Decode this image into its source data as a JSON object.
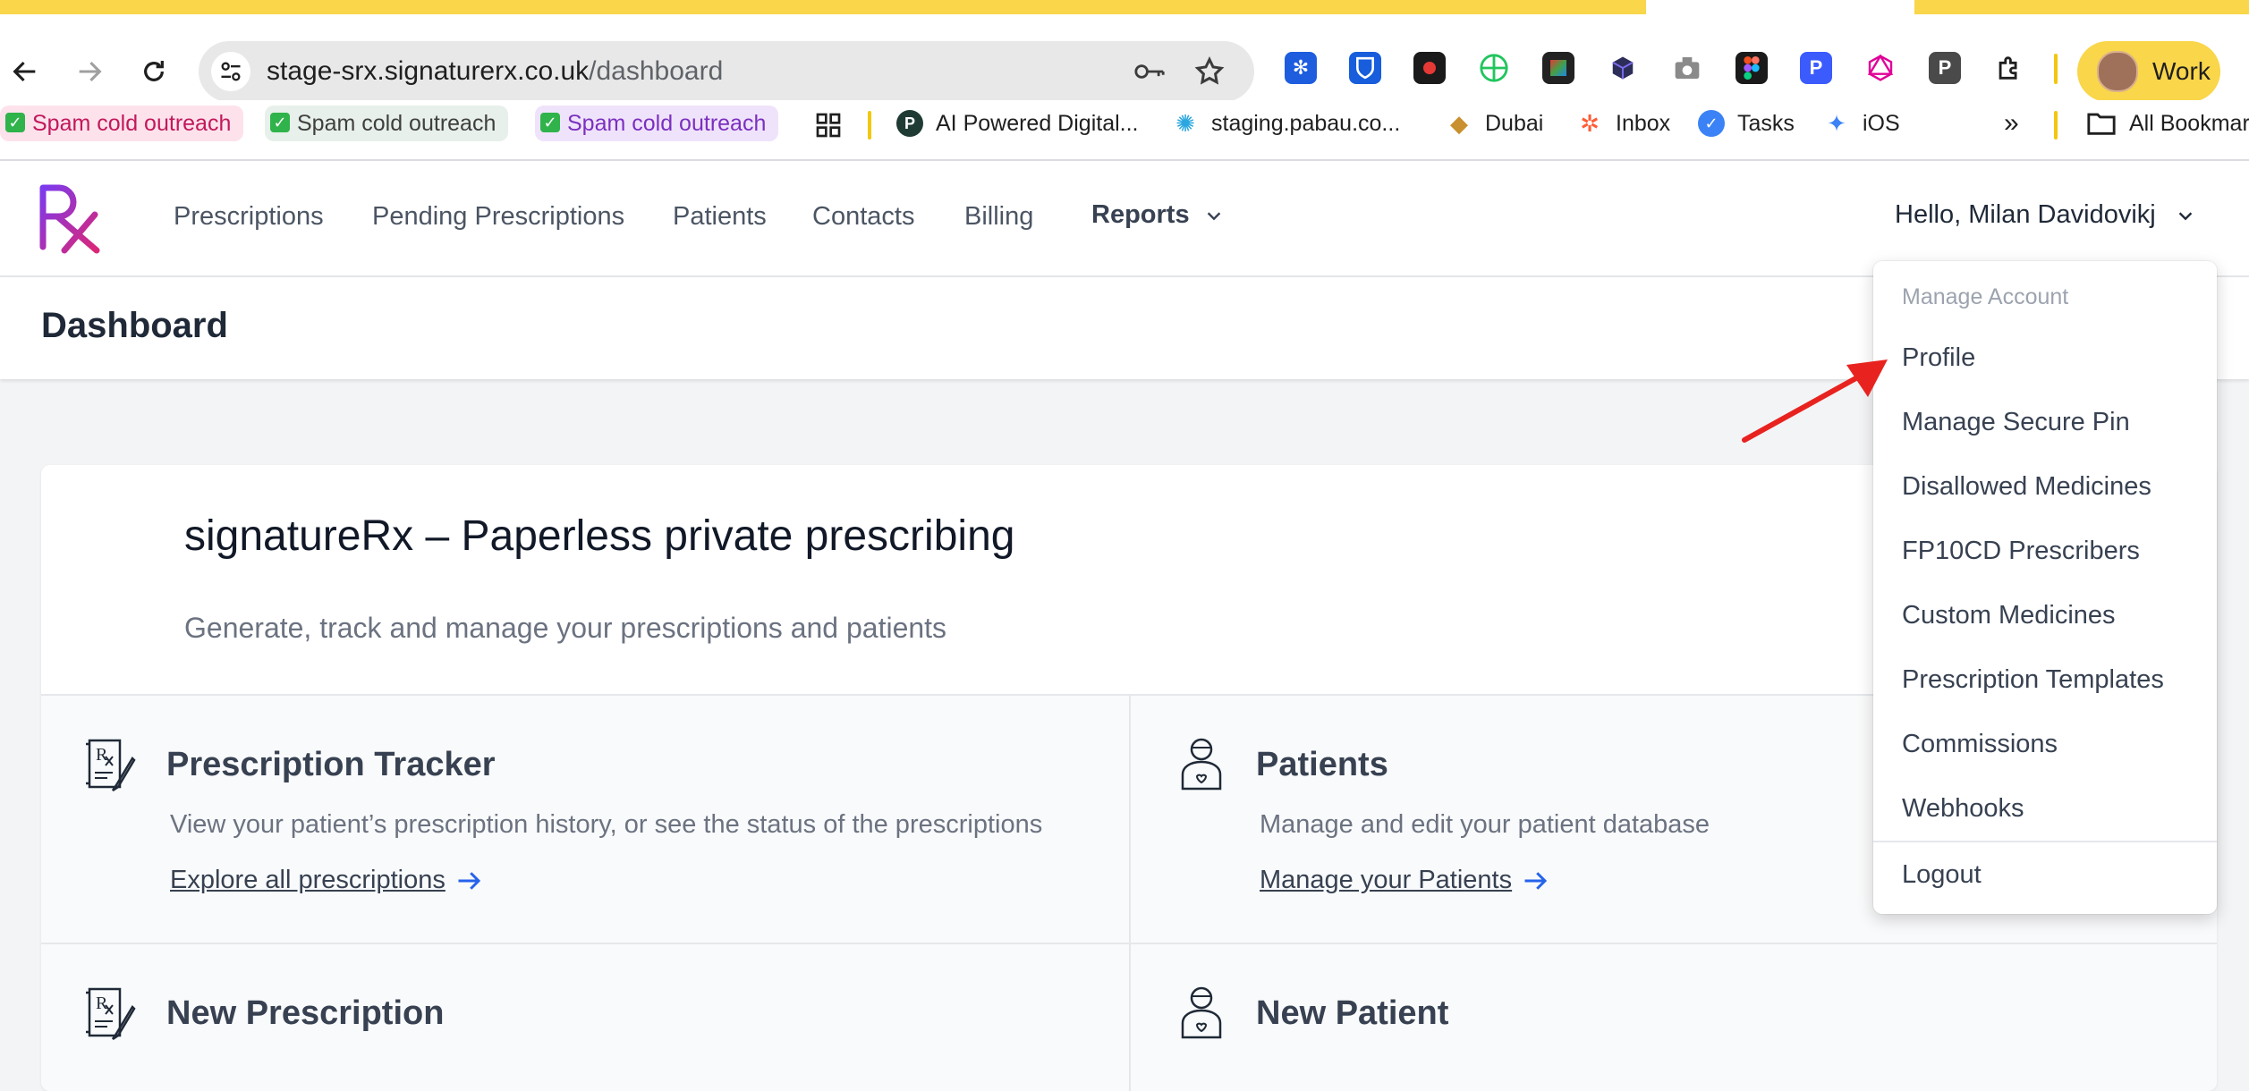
{
  "browser": {
    "url_host": "stage-srx.signaturerx.co.uk",
    "url_path": "/dashboard",
    "profile_label": "Work",
    "bookmarks_chips": [
      "Spam cold outreach",
      "Spam cold outreach",
      "Spam cold outreach"
    ],
    "bookmarks": [
      "AI Powered Digital...",
      "staging.pabau.co...",
      "Dubai",
      "Inbox",
      "Tasks",
      "iOS"
    ],
    "all_bookmarks": "All Bookmarks",
    "overflow": "»"
  },
  "app": {
    "logo_text": "Rx",
    "nav": [
      "Prescriptions",
      "Pending Prescriptions",
      "Patients",
      "Contacts",
      "Billing"
    ],
    "reports_label": "Reports",
    "greeting": "Hello, Milan Davidovikj"
  },
  "page": {
    "title": "Dashboard",
    "hero_title": "signatureRx – Paperless private prescribing",
    "hero_subtitle": "Generate, track and manage your prescriptions and patients"
  },
  "tiles": [
    {
      "title": "Prescription Tracker",
      "desc": "View your patient’s prescription history, or see the status of the prescriptions",
      "link": "Explore all prescriptions"
    },
    {
      "title": "Patients",
      "desc": "Manage and edit your patient database",
      "link": "Manage your Patients"
    },
    {
      "title": "New Prescription",
      "desc": "",
      "link": ""
    },
    {
      "title": "New Patient",
      "desc": "",
      "link": ""
    }
  ],
  "dropdown": {
    "header": "Manage Account",
    "items": [
      "Profile",
      "Manage Secure Pin",
      "Disallowed Medicines",
      "FP10CD Prescribers",
      "Custom Medicines",
      "Prescription Templates",
      "Commissions",
      "Webhooks"
    ],
    "logout": "Logout"
  },
  "colors": {
    "accent_yellow": "#f9d64a",
    "link_blue": "#2563eb",
    "annotation_red": "#e8231f",
    "logo_gradient": [
      "#7c3aed",
      "#db2777"
    ]
  }
}
